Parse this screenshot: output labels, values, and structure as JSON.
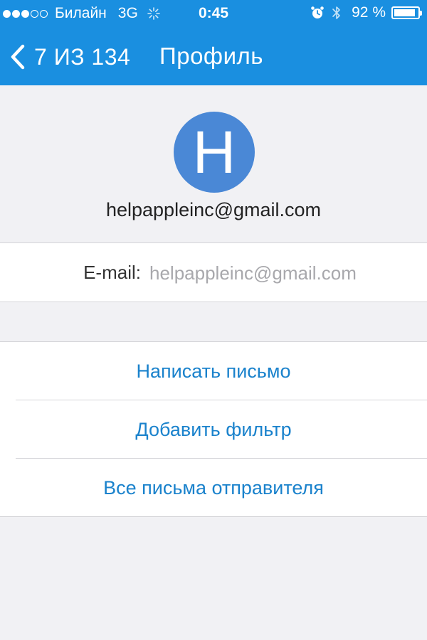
{
  "status_bar": {
    "signal_bars": [
      true,
      true,
      true,
      false,
      false
    ],
    "carrier": "Билайн",
    "network": "3G",
    "activity_icon": "spinner-icon",
    "time": "0:45",
    "alarm_icon": "alarm-icon",
    "bluetooth_icon": "bluetooth-icon",
    "battery_percent_text": "92 %",
    "battery_level": 0.92
  },
  "nav": {
    "back_icon": "chevron-left-icon",
    "back_label": "7 ИЗ 134",
    "title": "Профиль"
  },
  "profile": {
    "avatar_letter": "H",
    "email": "helpappleinc@gmail.com"
  },
  "details": {
    "email_label": "E-mail:",
    "email_value": "helpappleinc@gmail.com"
  },
  "actions": {
    "compose": "Написать письмо",
    "add_filter": "Добавить фильтр",
    "all_from_sender": "Все письма отправителя"
  },
  "colors": {
    "nav_bar": "#1a8fe0",
    "avatar": "#4a88d6",
    "action_text": "#1a82cc",
    "background": "#f1f1f4"
  }
}
